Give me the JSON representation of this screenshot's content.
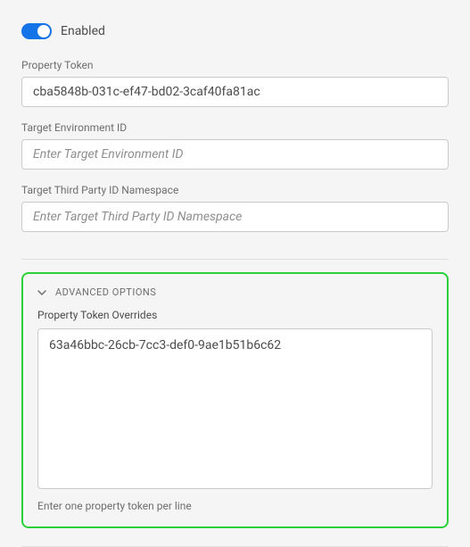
{
  "toggle": {
    "label": "Enabled",
    "state": true
  },
  "fields": {
    "propertyToken": {
      "label": "Property Token",
      "value": "cba5848b-031c-ef47-bd02-3caf40fa81ac"
    },
    "targetEnvironmentId": {
      "label": "Target Environment ID",
      "placeholder": "Enter Target Environment ID",
      "value": ""
    },
    "targetThirdPartyIdNamespace": {
      "label": "Target Third Party ID Namespace",
      "placeholder": "Enter Target Third Party ID Namespace",
      "value": ""
    }
  },
  "advanced": {
    "sectionTitle": "ADVANCED OPTIONS",
    "overrides": {
      "label": "Property Token Overrides",
      "value": "63a46bbc-26cb-7cc3-def0-9ae1b51b6c62",
      "helpText": "Enter one property token per line"
    }
  }
}
